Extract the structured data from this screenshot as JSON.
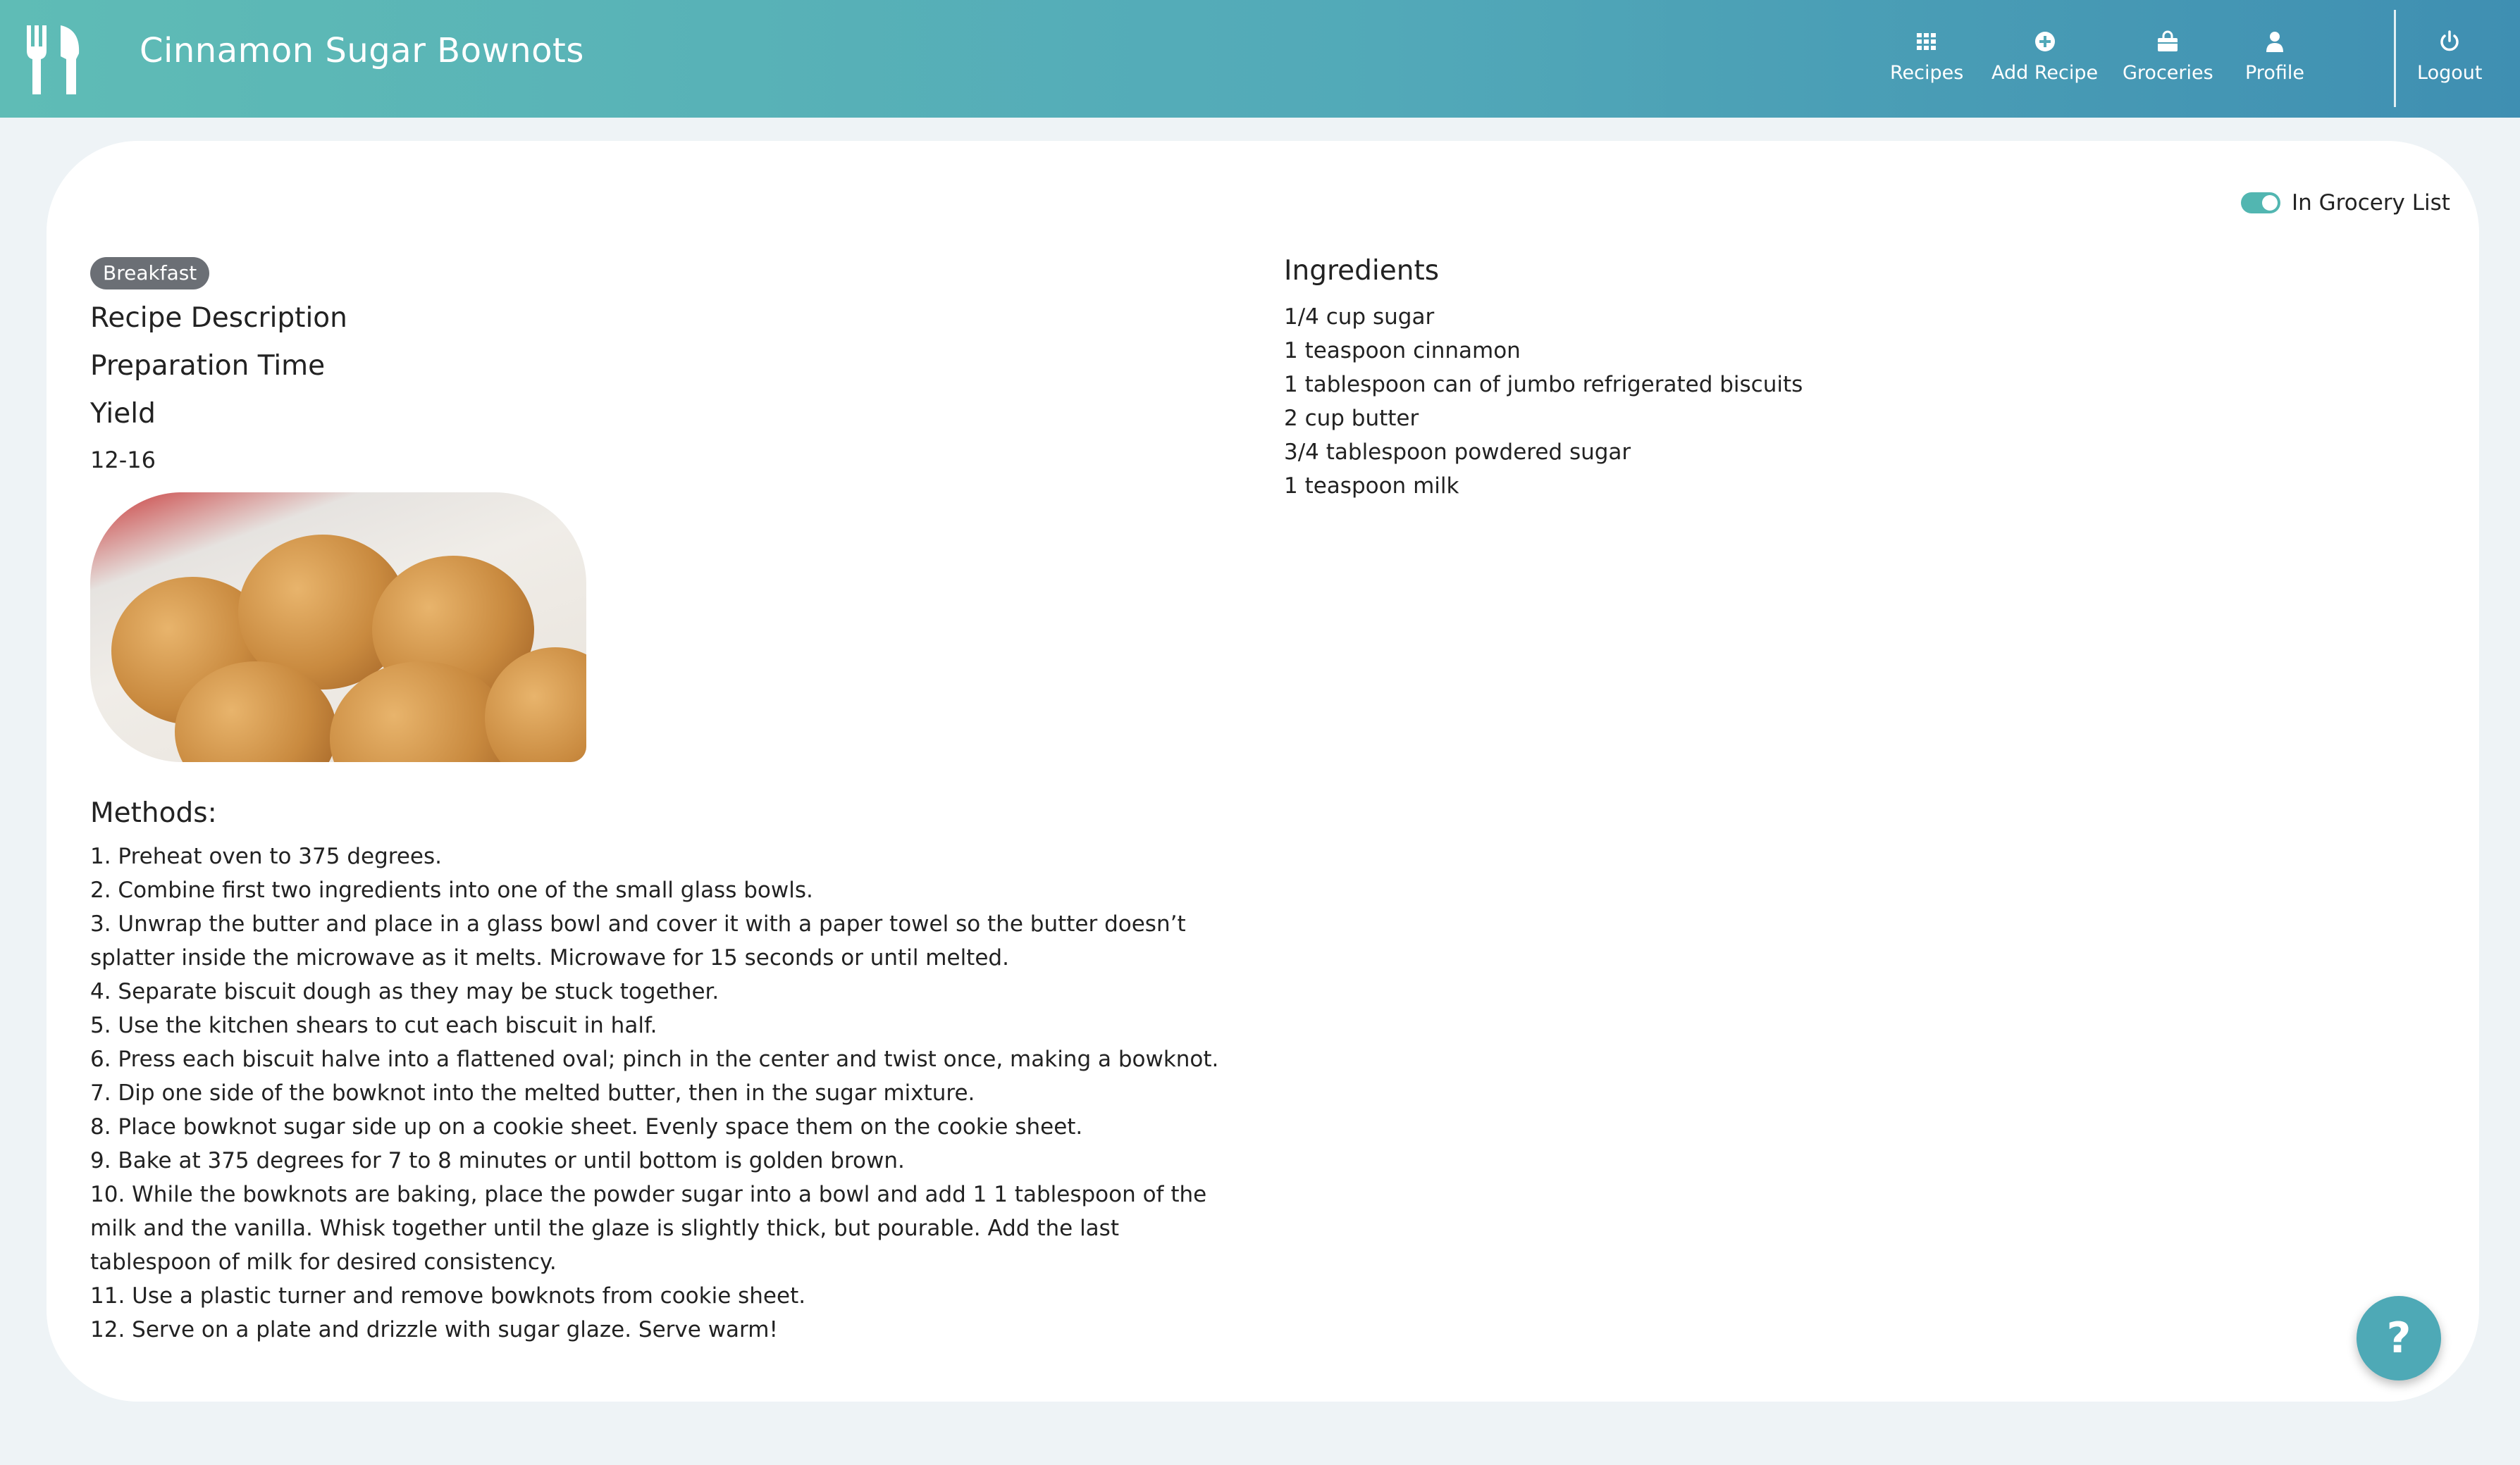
{
  "header": {
    "title": "Cinnamon Sugar Bownots",
    "nav": [
      {
        "label": "Recipes",
        "icon": "grid-icon"
      },
      {
        "label": "Add Recipe",
        "icon": "plus-circle-icon"
      },
      {
        "label": "Groceries",
        "icon": "shopping-bag-icon"
      },
      {
        "label": "Profile",
        "icon": "user-icon"
      },
      {
        "label": "Logout",
        "icon": "power-icon"
      }
    ]
  },
  "grocery_toggle": {
    "label": "In Grocery List",
    "checked": true
  },
  "recipe": {
    "category": "Breakfast",
    "description_heading": "Recipe Description",
    "prep_time_heading": "Preparation Time",
    "yield_heading": "Yield",
    "yield_value": "12-16",
    "methods_heading": "Methods:",
    "methods": [
      "1. Preheat oven to 375 degrees.",
      "2. Combine first two ingredients into one of the small glass bowls.",
      "3. Unwrap the butter and place in a glass bowl and cover it with a paper towel so the butter doesn’t splatter inside the microwave as it melts. Microwave for 15 seconds or until melted.",
      "4. Separate biscuit dough as they may be stuck together.",
      "5. Use the kitchen shears to cut each biscuit in half.",
      "6. Press each biscuit halve into a flattened oval; pinch in the center and twist once, making a bowknot.",
      "7. Dip one side of the bowknot into the melted butter, then in the sugar mixture.",
      "8. Place bowknot sugar side up on a cookie sheet. Evenly space them on the cookie sheet.",
      "9. Bake at 375 degrees for 7 to 8 minutes or until bottom is golden brown.",
      "10. While the bowknots are baking, place the powder sugar into a bowl and add 1 1 tablespoon of the milk and the vanilla. Whisk together until the glaze is slightly thick, but pourable. Add the last tablespoon of milk for desired consistency.",
      "11. Use a plastic turner and remove bowknots from cookie sheet.",
      "12. Serve on a plate and drizzle with sugar glaze. Serve warm!"
    ],
    "ingredients_heading": "Ingredients",
    "ingredients": [
      "1/4 cup sugar",
      "1 teaspoon cinnamon",
      "1 tablespoon can of jumbo refrigerated biscuits",
      "2 cup butter",
      "3/4 tablespoon powdered sugar",
      "1 teaspoon milk"
    ]
  },
  "help_button": {
    "label": "?"
  },
  "colors": {
    "header_start": "#5fbcb6",
    "header_end": "#3f8fb2",
    "accent": "#52b6b1",
    "badge": "#6b6f75"
  }
}
